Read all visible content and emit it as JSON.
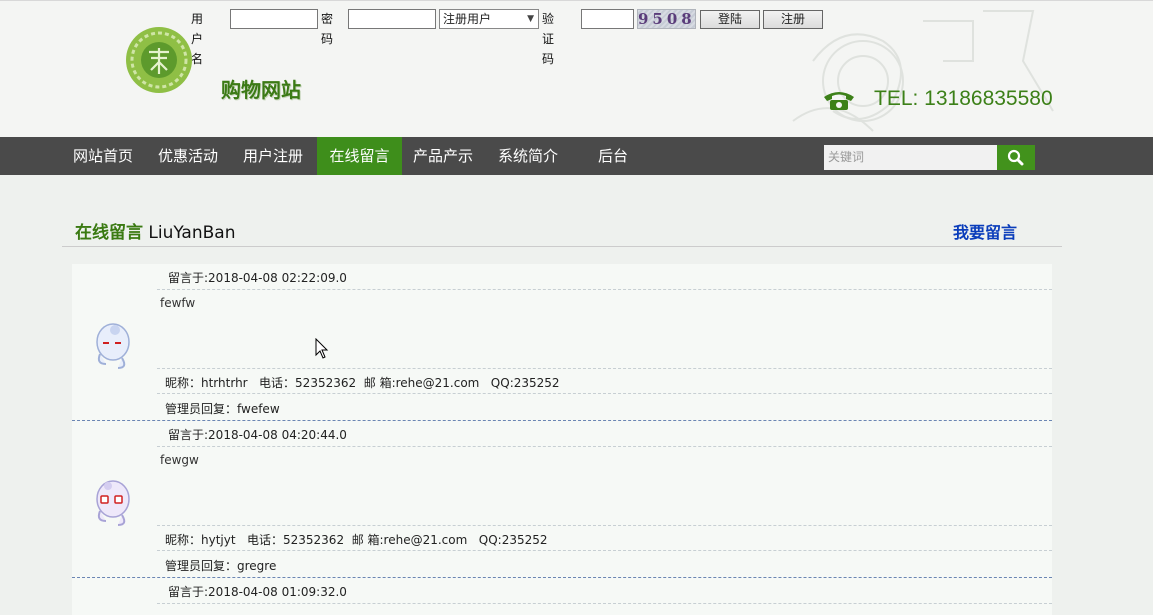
{
  "login": {
    "username_label": "用户名",
    "username_value": "",
    "password_label": "密码",
    "password_value": "",
    "role_selected": "注册用户",
    "captcha_label": "验证码",
    "captcha_value": "",
    "captcha_image_text": "9508",
    "login_button": "登陆",
    "register_button": "注册"
  },
  "site": {
    "name": "购物网站",
    "tel": "TEL: 13186835580",
    "accent_color": "#3e8e1b"
  },
  "nav": {
    "items": [
      "网站首页",
      "优惠活动",
      "用户注册",
      "在线留言",
      "产品产示",
      "系统简介",
      "后台"
    ],
    "active_index": 3,
    "search_placeholder": "关键词"
  },
  "board": {
    "title_cn": "在线留言",
    "title_en": "LiuYanBan",
    "write_link": "我要留言",
    "messages": [
      {
        "time": "留言于:2018-04-08 02:22:09.0",
        "content": "fewfw",
        "info": "昵称：htrhtrhr   电话：52352362  邮 箱:rehe@21.com   QQ:235252",
        "reply": "管理员回复：fwefew"
      },
      {
        "time": "留言于:2018-04-08 04:20:44.0",
        "content": "fewgw",
        "info": "昵称：hytjyt   电话：52352362  邮 箱:rehe@21.com   QQ:235252",
        "reply": "管理员回复：gregre"
      },
      {
        "time": "留言于:2018-04-08 01:09:32.0"
      }
    ]
  }
}
